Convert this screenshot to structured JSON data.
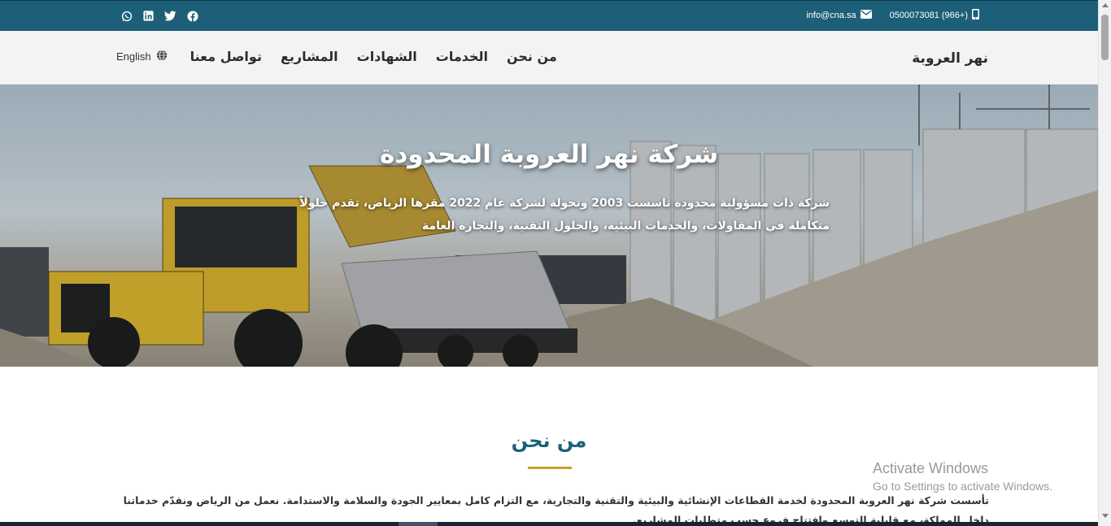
{
  "topbar": {
    "social_icons": [
      "whatsapp-icon",
      "linkedin-icon",
      "twitter-icon",
      "facebook-icon"
    ],
    "email": "info@cna.sa",
    "phone": "0500073081 (966+)",
    "bg_color": "#1d5f78"
  },
  "navbar": {
    "brand": "نهر العروبة",
    "lang_label": "English",
    "links": [
      "من نحن",
      "الخدمات",
      "الشهادات",
      "المشاريع",
      "تواصل معنا"
    ]
  },
  "hero": {
    "title": "شركة نهر العروبة المحدودة",
    "subtitle": "شركة ذات مسؤولية محدودة تاسست 2003 وتحولة لشركة عام 2022 مقرها الرياض، تقدم حلولاً متكاملة في المقاولات، والخدمات البيئية، والحلول التقنية، والتجارة العامة"
  },
  "about": {
    "title": "من نحن",
    "text": "تأسست شركة نهر العروبة المحدودة لخدمة القطاعات الإنشائية والبيئية والتقنية والتجارية، مع التزام كامل بمعايير الجودة والسلامة والاستدامة. نعمل من الرياض ونقدّم خدماتنا داخل المملكة، مع قابلية التوسع وافتتاح فروع حسب متطلبات المشاريع.",
    "accent_color": "#c9a227"
  },
  "watermark": {
    "line1": "Activate Windows",
    "line2": "Go to Settings to activate Windows."
  }
}
